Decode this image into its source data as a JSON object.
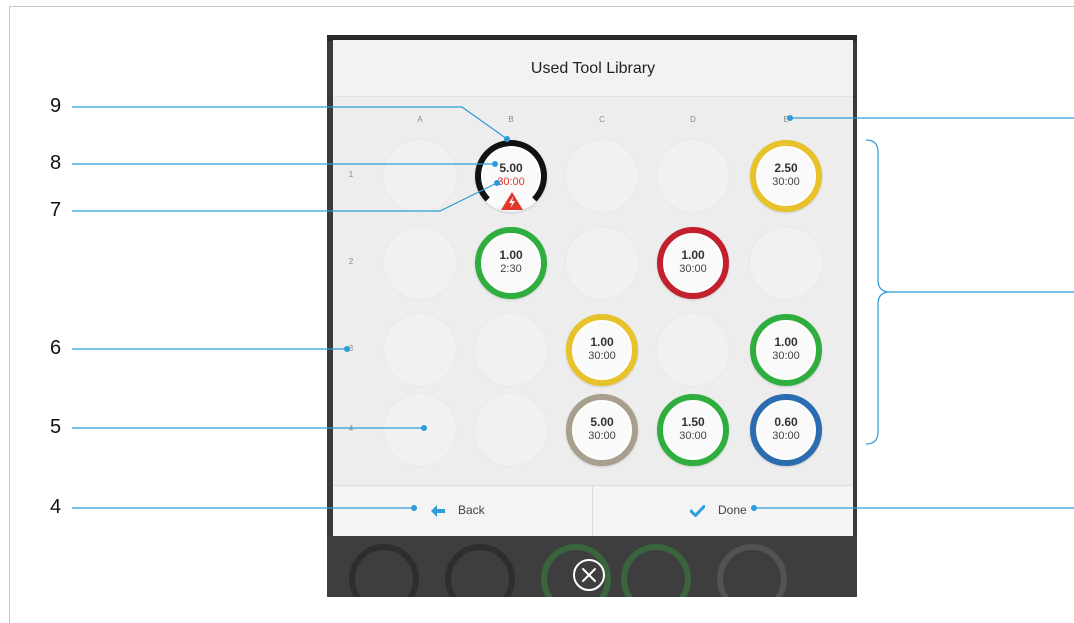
{
  "dialog": {
    "title": "Used Tool Library",
    "columns": [
      "A",
      "B",
      "C",
      "D",
      "E"
    ],
    "rows": [
      "1",
      "2",
      "3",
      "4"
    ],
    "grid": [
      [
        {
          "empty": true
        },
        {
          "empty": false,
          "value": "5.00",
          "time": "30:00",
          "color": "#111111",
          "alert": true
        },
        {
          "empty": true
        },
        {
          "empty": true
        },
        {
          "empty": false,
          "value": "2.50",
          "time": "30:00",
          "color": "#e8c22a"
        }
      ],
      [
        {
          "empty": true
        },
        {
          "empty": false,
          "value": "1.00",
          "time": "2:30",
          "color": "#2fae3f"
        },
        {
          "empty": true
        },
        {
          "empty": false,
          "value": "1.00",
          "time": "30:00",
          "color": "#c3202e"
        },
        {
          "empty": true
        }
      ],
      [
        {
          "empty": true
        },
        {
          "empty": true
        },
        {
          "empty": false,
          "value": "1.00",
          "time": "30:00",
          "color": "#e8c22a"
        },
        {
          "empty": true
        },
        {
          "empty": false,
          "value": "1.00",
          "time": "30:00",
          "color": "#2fae3f"
        }
      ],
      [
        {
          "empty": true
        },
        {
          "empty": true
        },
        {
          "empty": false,
          "value": "5.00",
          "time": "30:00",
          "color": "#a89f8e"
        },
        {
          "empty": false,
          "value": "1.50",
          "time": "30:00",
          "color": "#2fae3f"
        },
        {
          "empty": false,
          "value": "0.60",
          "time": "30:00",
          "color": "#2b6cb0"
        }
      ]
    ],
    "footer": {
      "back_label": "Back",
      "back_icon": "arrow-left-icon",
      "done_label": "Done",
      "done_icon": "checkmark-icon"
    },
    "close_icon": "close-circle-icon",
    "alert_icon": "warning-lightning-icon"
  },
  "callouts": {
    "c9": "9",
    "c8": "8",
    "c7": "7",
    "c6": "6",
    "c5": "5",
    "c4": "4"
  },
  "colors": {
    "callout_line": "#2d9cdb",
    "accent_blue": "#2d9cdb",
    "alert_red": "#e2372b"
  }
}
